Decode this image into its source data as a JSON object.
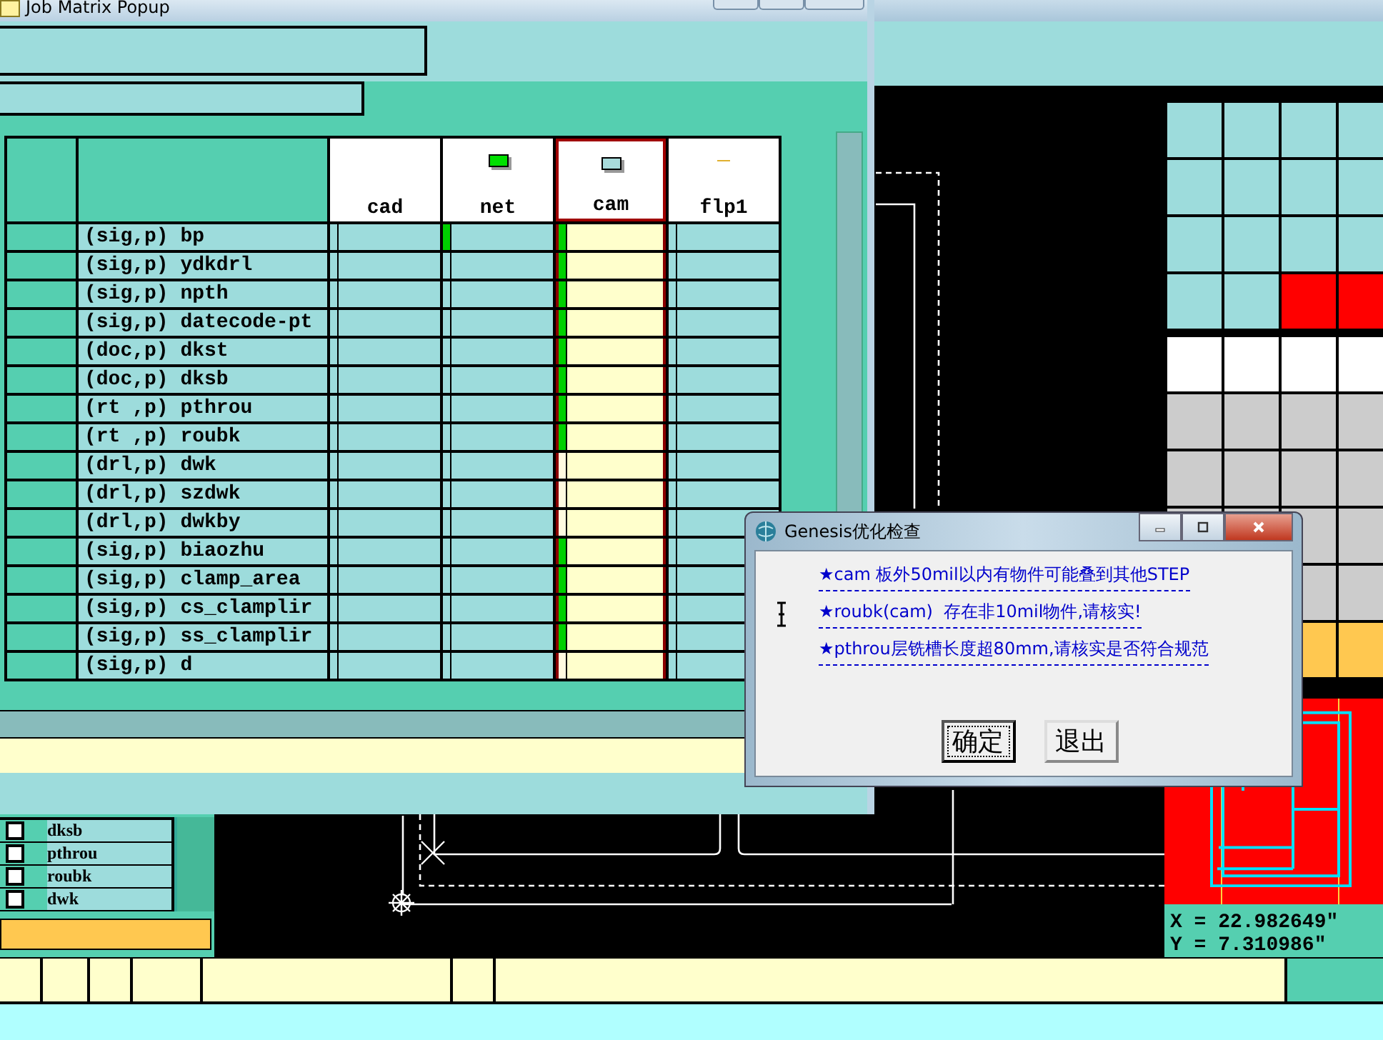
{
  "job_matrix": {
    "title": "Job Matrix Popup",
    "columns": [
      {
        "label": "cad",
        "kind": "none",
        "selected": false
      },
      {
        "label": "net",
        "kind": "box",
        "color": "#00e000",
        "selected": false
      },
      {
        "label": "cam",
        "kind": "box",
        "color": "#a8dcdc",
        "selected": true
      },
      {
        "label": "flp1",
        "kind": "dash",
        "color": "#e0b030",
        "selected": false
      }
    ],
    "rows": [
      {
        "layer": "(sig,p) bp",
        "cells": [
          {
            "marked": false
          },
          {
            "marked": true
          },
          {
            "marked": true
          },
          {
            "marked": false
          }
        ]
      },
      {
        "layer": "(sig,p) ydkdrl",
        "cells": [
          {
            "marked": false
          },
          {
            "marked": false
          },
          {
            "marked": true
          },
          {
            "marked": false
          }
        ]
      },
      {
        "layer": "(sig,p) npth",
        "cells": [
          {
            "marked": false
          },
          {
            "marked": false
          },
          {
            "marked": true
          },
          {
            "marked": false
          }
        ]
      },
      {
        "layer": "(sig,p) datecode-pt",
        "cells": [
          {
            "marked": false
          },
          {
            "marked": false
          },
          {
            "marked": true
          },
          {
            "marked": false
          }
        ]
      },
      {
        "layer": "(doc,p) dkst",
        "cells": [
          {
            "marked": false
          },
          {
            "marked": false
          },
          {
            "marked": true
          },
          {
            "marked": false
          }
        ]
      },
      {
        "layer": "(doc,p) dksb",
        "cells": [
          {
            "marked": false
          },
          {
            "marked": false
          },
          {
            "marked": true
          },
          {
            "marked": false
          }
        ]
      },
      {
        "layer": "(rt ,p) pthrou",
        "cells": [
          {
            "marked": false
          },
          {
            "marked": false
          },
          {
            "marked": true
          },
          {
            "marked": false
          }
        ]
      },
      {
        "layer": "(rt ,p) roubk",
        "cells": [
          {
            "marked": false
          },
          {
            "marked": false
          },
          {
            "marked": true
          },
          {
            "marked": false
          }
        ]
      },
      {
        "layer": "(drl,p) dwk",
        "cells": [
          {
            "marked": false
          },
          {
            "marked": false
          },
          {
            "marked": false
          },
          {
            "marked": false
          }
        ]
      },
      {
        "layer": "(drl,p) szdwk",
        "cells": [
          {
            "marked": false
          },
          {
            "marked": false
          },
          {
            "marked": false
          },
          {
            "marked": false
          }
        ]
      },
      {
        "layer": "(drl,p) dwkby",
        "cells": [
          {
            "marked": false
          },
          {
            "marked": false
          },
          {
            "marked": false
          },
          {
            "marked": false
          }
        ]
      },
      {
        "layer": "(sig,p) biaozhu",
        "cells": [
          {
            "marked": false
          },
          {
            "marked": false
          },
          {
            "marked": true
          },
          {
            "marked": false
          }
        ]
      },
      {
        "layer": "(sig,p) clamp_area",
        "cells": [
          {
            "marked": false
          },
          {
            "marked": false
          },
          {
            "marked": true
          },
          {
            "marked": false
          }
        ]
      },
      {
        "layer": "(sig,p) cs_clamplir",
        "cells": [
          {
            "marked": false
          },
          {
            "marked": false
          },
          {
            "marked": true
          },
          {
            "marked": false
          }
        ]
      },
      {
        "layer": "(sig,p) ss_clamplir",
        "cells": [
          {
            "marked": false
          },
          {
            "marked": false
          },
          {
            "marked": true
          },
          {
            "marked": false
          }
        ]
      },
      {
        "layer": "(sig,p) d",
        "cells": [
          {
            "marked": false
          },
          {
            "marked": false
          },
          {
            "marked": false
          },
          {
            "marked": false
          }
        ]
      }
    ]
  },
  "layer_list": [
    {
      "name": "dksb",
      "checked": false
    },
    {
      "name": "pthrou",
      "checked": false
    },
    {
      "name": "roubk",
      "checked": false
    },
    {
      "name": "dwk",
      "checked": false
    }
  ],
  "palette": [
    {
      "cells": [
        {
          "color": "#9ddcdc"
        },
        {
          "color": "#9ddcdc"
        },
        {
          "color": "#9ddcdc"
        },
        {
          "color": "#9ddcdc"
        }
      ]
    },
    {
      "cells": [
        {
          "color": "#9ddcdc"
        },
        {
          "color": "#9ddcdc"
        },
        {
          "color": "#9ddcdc"
        },
        {
          "color": "#9ddcdc"
        }
      ]
    },
    {
      "cells": [
        {
          "color": "#9ddcdc"
        },
        {
          "color": "#9ddcdc"
        },
        {
          "color": "#9ddcdc"
        },
        {
          "color": "#9ddcdc"
        }
      ]
    },
    {
      "cells": [
        {
          "color": "#9ddcdc"
        },
        {
          "color": "#9ddcdc"
        },
        {
          "color": "#ff0000"
        },
        {
          "color": "#ff0000"
        }
      ]
    },
    {
      "cells": [
        {
          "color": "#ffffff"
        },
        {
          "color": "#ffffff"
        },
        {
          "color": "#ffffff"
        },
        {
          "color": "#ffffff"
        }
      ]
    },
    {
      "cells": [
        {
          "color": "#cccccc"
        },
        {
          "color": "#cccccc"
        },
        {
          "color": "#cccccc"
        },
        {
          "color": "#cccccc"
        }
      ]
    },
    {
      "cells": [
        {
          "color": "#cccccc"
        },
        {
          "color": "#cccccc"
        },
        {
          "color": "#cccccc"
        },
        {
          "color": "#cccccc"
        }
      ]
    },
    {
      "cells": [
        {
          "color": "#cccccc"
        },
        {
          "color": "#cccccc"
        },
        {
          "color": "#cccccc"
        },
        {
          "color": "#cccccc"
        }
      ]
    },
    {
      "cells": [
        {
          "color": "#cccccc"
        },
        {
          "color": "#cccccc"
        }
      ]
    },
    {
      "cells": [
        {
          "color": "#ffc850"
        },
        {
          "color": "#ffc850"
        }
      ]
    }
  ],
  "coordinates": {
    "x": "X = 22.982649\"",
    "y": "Y = 7.310986\""
  },
  "dialog": {
    "title": "Genesis优化检查",
    "messages": [
      "★cam 板外50mil以内有物件可能叠到其他STEP",
      "★roubk(cam)  存在非10mil物件,请核实!",
      "★pthrou层铣槽长度超80mm,请核实是否符合规范"
    ],
    "buttons": [
      {
        "label": "确定",
        "focused": true
      },
      {
        "label": "退出",
        "focused": false
      }
    ]
  }
}
